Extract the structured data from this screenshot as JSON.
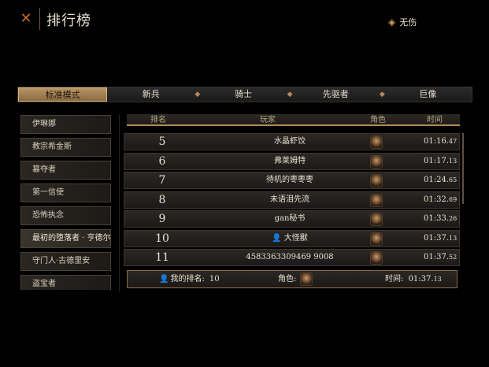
{
  "header": {
    "close_icon": "close-x-icon",
    "title": "排行榜",
    "difficulty_label": "无伤"
  },
  "tabs": [
    {
      "label": "标准模式",
      "active": true
    },
    {
      "label": "新兵"
    },
    {
      "label": "骑士"
    },
    {
      "label": "先驱者"
    },
    {
      "label": "巨像"
    }
  ],
  "sidebar": {
    "items": [
      {
        "label": "伊琳娜"
      },
      {
        "label": "教宗希金斯"
      },
      {
        "label": "篡夺者"
      },
      {
        "label": "第一信使"
      },
      {
        "label": "恐怖执念"
      },
      {
        "label": "最初的堕落者 · 亨德尔",
        "selected": true
      },
      {
        "label": "守门人·古德里安"
      },
      {
        "label": "盗宝者"
      }
    ]
  },
  "table": {
    "columns": {
      "rank": "排名",
      "player": "玩家",
      "role": "角色",
      "time": "时间"
    },
    "rows": [
      {
        "rank": "5",
        "player": "水晶虾饺",
        "time_main": "01:16.",
        "time_ms": "47"
      },
      {
        "rank": "6",
        "player": "弗莱姆特",
        "time_main": "01:17.",
        "time_ms": "13"
      },
      {
        "rank": "7",
        "player": "待机的枣枣枣",
        "time_main": "01:24.",
        "time_ms": "65"
      },
      {
        "rank": "8",
        "player": "未语泪先流",
        "time_main": "01:32.",
        "time_ms": "69"
      },
      {
        "rank": "9",
        "player": "gan秘书",
        "time_main": "01:33.",
        "time_ms": "26"
      },
      {
        "rank": "10",
        "player": "大怪獸",
        "time_main": "01:37.",
        "time_ms": "13",
        "is_me": true
      },
      {
        "rank": "11",
        "player": "4583363309469 9008",
        "time_main": "01:37.",
        "time_ms": "52"
      }
    ]
  },
  "footer": {
    "my_rank_label": "我的排名:",
    "my_rank_value": "10",
    "role_label": "角色:",
    "time_label": "时间:",
    "time_main": "01:37.",
    "time_ms": "13"
  }
}
